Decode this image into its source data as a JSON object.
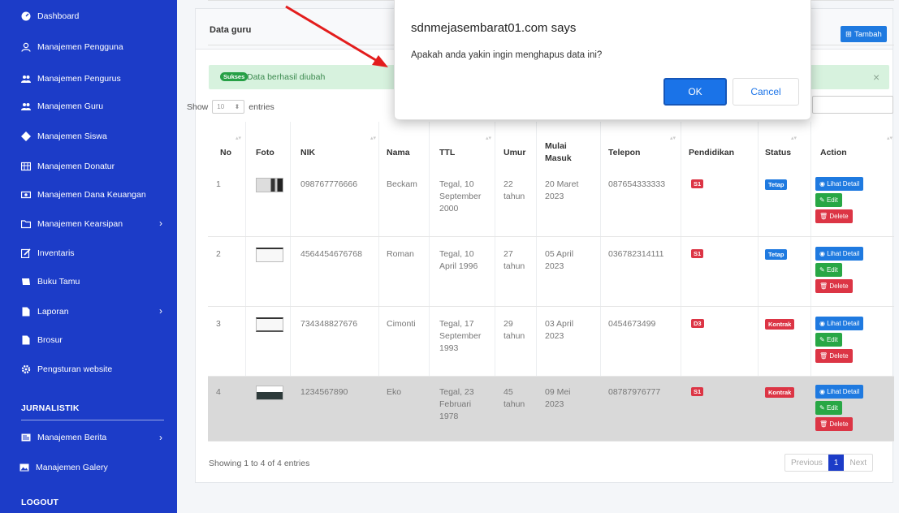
{
  "sidebar": {
    "items": [
      {
        "label": "Dashboard",
        "icon": "dashboard-icon"
      },
      {
        "label": "Manajemen Pengguna",
        "icon": "user-icon"
      },
      {
        "label": "Manajemen Pengurus",
        "icon": "users-icon"
      },
      {
        "label": "Manajemen Guru",
        "icon": "users-icon"
      },
      {
        "label": "Manajemen Siswa",
        "icon": "student-icon"
      },
      {
        "label": "Manajemen Donatur",
        "icon": "table-icon"
      },
      {
        "label": "Manajemen Dana Keuangan",
        "icon": "money-icon"
      },
      {
        "label": "Manajemen Kearsipan",
        "icon": "archive-icon"
      },
      {
        "label": "Inventaris",
        "icon": "edit-icon"
      },
      {
        "label": "Buku Tamu",
        "icon": "book-icon"
      },
      {
        "label": "Laporan",
        "icon": "file-icon"
      },
      {
        "label": "Brosur",
        "icon": "file-icon"
      },
      {
        "label": "Pengsturan website",
        "icon": "gear-icon"
      }
    ],
    "section_jurnalistik": "JURNALISTIK",
    "items2": [
      {
        "label": "Manajemen Berita",
        "icon": "news-icon"
      },
      {
        "label": "Manajemen Galery",
        "icon": "image-icon"
      }
    ],
    "logout": "LOGOUT"
  },
  "card": {
    "title": "Data guru",
    "add_button": "Tambah"
  },
  "alert": {
    "badge": "Sukses",
    "text": "Data berhasil diubah",
    "close": "×"
  },
  "length": {
    "prefix": "Show",
    "value": "10",
    "suffix": "entries"
  },
  "table": {
    "headers": [
      "No",
      "Foto",
      "NIK",
      "Nama",
      "TTL",
      "Umur",
      "Mulai Masuk",
      "Telepon",
      "Pendidikan",
      "Status",
      "Action"
    ],
    "rows": [
      {
        "no": "1",
        "nik": "098767776666",
        "nama": "Beckam",
        "ttl": "Tegal, 10 September 2000",
        "umur": "22 tahun",
        "masuk": "20 Maret 2023",
        "telepon": "087654333333",
        "pendidikan": "S1",
        "status": "Tetap"
      },
      {
        "no": "2",
        "nik": "4564454676768",
        "nama": "Roman",
        "ttl": "Tegal, 10 April 1996",
        "umur": "27 tahun",
        "masuk": "05 April 2023",
        "telepon": "036782314111",
        "pendidikan": "S1",
        "status": "Tetap"
      },
      {
        "no": "3",
        "nik": "734348827676",
        "nama": "Cimonti",
        "ttl": "Tegal, 17 September 1993",
        "umur": "29 tahun",
        "masuk": "03 April 2023",
        "telepon": "0454673499",
        "pendidikan": "D3",
        "status": "Kontrak"
      },
      {
        "no": "4",
        "nik": "1234567890",
        "nama": "Eko",
        "ttl": "Tegal, 23 Februari 1978",
        "umur": "45 tahun",
        "masuk": "09 Mei 2023",
        "telepon": "08787976777",
        "pendidikan": "S1",
        "status": "Kontrak"
      }
    ],
    "actions": {
      "detail": "Lihat Detail",
      "edit": "Edit",
      "delete": "Delete"
    }
  },
  "footer": {
    "info": "Showing 1 to 4 of 4 entries",
    "prev": "Previous",
    "page": "1",
    "next": "Next"
  },
  "dialog": {
    "title": "sdnmejasembarat01.com says",
    "message": "Apakah anda yakin ingin menghapus data ini?",
    "ok": "OK",
    "cancel": "Cancel"
  },
  "colors": {
    "sidebar": "#1c3cc8",
    "primary": "#1f7ae0",
    "success": "#28a745",
    "danger": "#dc3545"
  }
}
